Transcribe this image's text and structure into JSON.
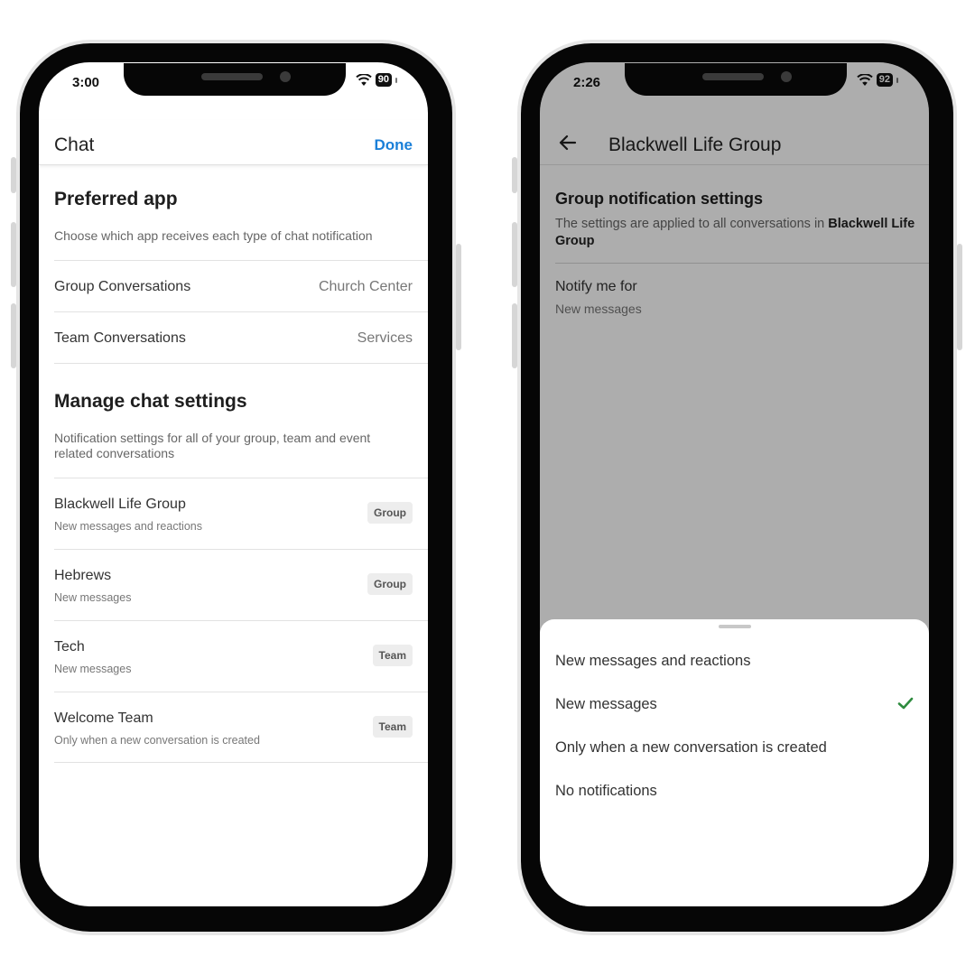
{
  "left_phone": {
    "status": {
      "time": "3:00",
      "battery": "90"
    },
    "header": {
      "title": "Chat",
      "done_label": "Done"
    },
    "preferred": {
      "heading": "Preferred app",
      "description": "Choose which app receives each type of chat notification",
      "rows": [
        {
          "label": "Group Conversations",
          "value": "Church Center"
        },
        {
          "label": "Team Conversations",
          "value": "Services"
        }
      ]
    },
    "manage": {
      "heading": "Manage chat settings",
      "description": "Notification settings for all of your group, team and event related conversations",
      "items": [
        {
          "name": "Blackwell Life Group",
          "subtitle": "New messages and reactions",
          "badge": "Group"
        },
        {
          "name": "Hebrews",
          "subtitle": "New messages",
          "badge": "Group"
        },
        {
          "name": "Tech",
          "subtitle": "New messages",
          "badge": "Team"
        },
        {
          "name": "Welcome Team",
          "subtitle": "Only when a new conversation is created",
          "badge": "Team"
        }
      ]
    }
  },
  "right_phone": {
    "status": {
      "time": "2:26",
      "battery": "92"
    },
    "header": {
      "title": "Blackwell Life Group",
      "back_icon": "arrow-left-icon"
    },
    "section": {
      "heading": "Group notification settings",
      "description_prefix": "The settings are applied to all conversations in ",
      "description_group": "Blackwell Life Group"
    },
    "notify": {
      "label": "Notify me for",
      "value": "New messages"
    },
    "sheet": {
      "options": [
        {
          "label": "New messages and reactions",
          "selected": false
        },
        {
          "label": "New messages",
          "selected": true
        },
        {
          "label": "Only when a new conversation is created",
          "selected": false
        },
        {
          "label": "No notifications",
          "selected": false
        }
      ],
      "check_color": "#2e8b3e"
    }
  }
}
